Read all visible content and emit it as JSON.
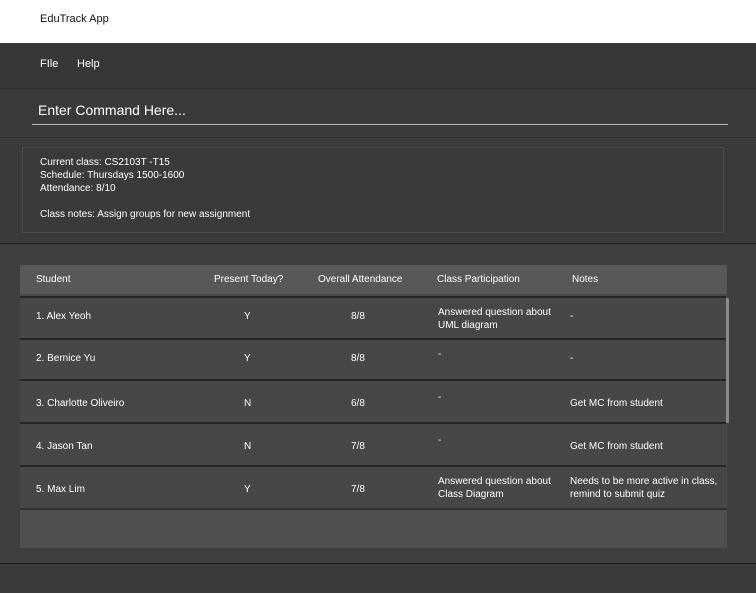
{
  "app": {
    "title": "EduTrack App"
  },
  "menu": {
    "items": [
      "FIle",
      "Help"
    ]
  },
  "command": {
    "placeholder": "Enter Command Here..."
  },
  "class_info": {
    "current_class": "Current class: CS2103T -T15",
    "schedule": "Schedule: Thursdays 1500-1600",
    "attendance": "Attendance: 8/10",
    "notes": "Class notes: Assign groups for new assignment"
  },
  "table": {
    "headers": [
      "Student",
      "Present Today?",
      "Overall Attendance",
      "Class Participation",
      "Notes"
    ],
    "rows": [
      {
        "student": "1. Alex Yeoh",
        "present": "Y",
        "attendance": "8/8",
        "participation": "Answered question about UML diagram",
        "notes": "-"
      },
      {
        "student": "2. Bernice Yu",
        "present": "Y",
        "attendance": "8/8",
        "participation": "-",
        "notes": "-"
      },
      {
        "student": "3. Charlotte Oliveiro",
        "present": "N",
        "attendance": "6/8",
        "participation": "-",
        "notes": "Get MC from student"
      },
      {
        "student": "4. Jason Tan",
        "present": "N",
        "attendance": "7/8",
        "participation": "-",
        "notes": "Get MC from student"
      },
      {
        "student": "5. Max Lim",
        "present": "Y",
        "attendance": "7/8",
        "participation": "Answered question about Class Diagram",
        "notes": "Needs to be more active in class, remind to submit quiz"
      }
    ]
  }
}
